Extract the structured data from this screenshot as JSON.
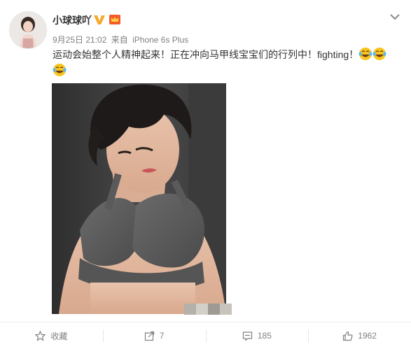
{
  "post": {
    "username": "小球球吖",
    "date": "9月25日 21:02",
    "source_prefix": "来自",
    "source": "iPhone 6s Plus",
    "text": "运动会始整个人精神起来！正在冲向马甲线宝宝们的行列中！fighting！",
    "emoji": "laugh-tears-emoji"
  },
  "actions": {
    "favorite_label": "收藏",
    "repost_count": "7",
    "comment_count": "185",
    "like_count": "1962"
  },
  "colors": {
    "accent_orange": "#f7a829",
    "meta_gray": "#808080",
    "text": "#333333"
  }
}
